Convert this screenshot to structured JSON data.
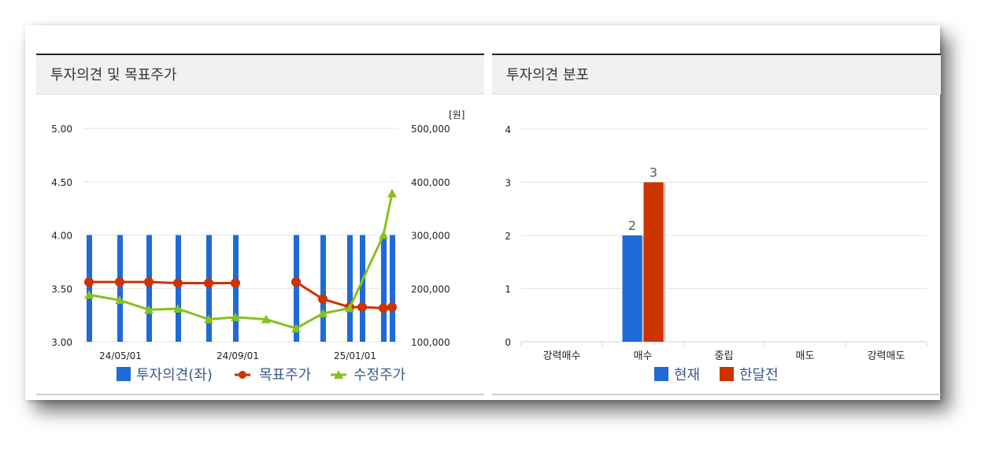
{
  "left_panel": {
    "title": "투자의견 및 목표주가"
  },
  "right_panel": {
    "title": "투자의견 분포"
  },
  "colors": {
    "blue": "#1f6ad6",
    "red": "#cc3300",
    "green": "#88c021"
  },
  "chart_data": [
    {
      "type": "bar",
      "title": "투자의견 및 목표주가",
      "y_left": {
        "ylim": [
          3.0,
          5.0
        ],
        "ticks": [
          "3.00",
          "3.50",
          "4.00",
          "4.50",
          "5.00"
        ]
      },
      "y_right": {
        "unit": "[원]",
        "ylim": [
          100000,
          500000
        ],
        "ticks": [
          "100,000",
          "200,000",
          "300,000",
          "400,000",
          "500,000"
        ]
      },
      "x_tick_labels": [
        "24/05/01",
        "24/09/01",
        "25/01/01"
      ],
      "series": [
        {
          "name": "투자의견(좌)",
          "type": "bar",
          "axis": "left",
          "color": "#1f6ad6",
          "values": [
            4,
            4,
            4,
            4,
            4,
            4,
            null,
            null,
            4,
            4,
            4,
            4,
            4,
            4
          ]
        },
        {
          "name": "목표주가",
          "type": "line",
          "axis": "right",
          "color": "#cc3300",
          "values": [
            212000,
            212000,
            212000,
            210000,
            210000,
            210000,
            null,
            null,
            212000,
            180000,
            165000,
            165000,
            163000,
            165000
          ]
        },
        {
          "name": "수정주가",
          "type": "line",
          "axis": "right",
          "color": "#88c021",
          "values": [
            188000,
            178000,
            160000,
            162000,
            142000,
            146000,
            142000,
            125000,
            153000,
            163000,
            300000,
            378000
          ]
        }
      ],
      "legend": [
        "투자의견(좌)",
        "목표주가",
        "수정주가"
      ],
      "legend_position": "bottom"
    },
    {
      "type": "bar",
      "title": "투자의견 분포",
      "categories": [
        "강력매수",
        "매수",
        "중립",
        "매도",
        "강력매도"
      ],
      "ylim": [
        0,
        4
      ],
      "y_ticks": [
        "0",
        "1",
        "2",
        "3",
        "4"
      ],
      "series": [
        {
          "name": "현재",
          "color": "#1f6ad6",
          "values": [
            0,
            2,
            0,
            0,
            0
          ]
        },
        {
          "name": "한달전",
          "color": "#cc3300",
          "values": [
            0,
            3,
            0,
            0,
            0
          ]
        }
      ],
      "data_labels": [
        "2",
        "3"
      ],
      "legend_position": "bottom"
    }
  ]
}
